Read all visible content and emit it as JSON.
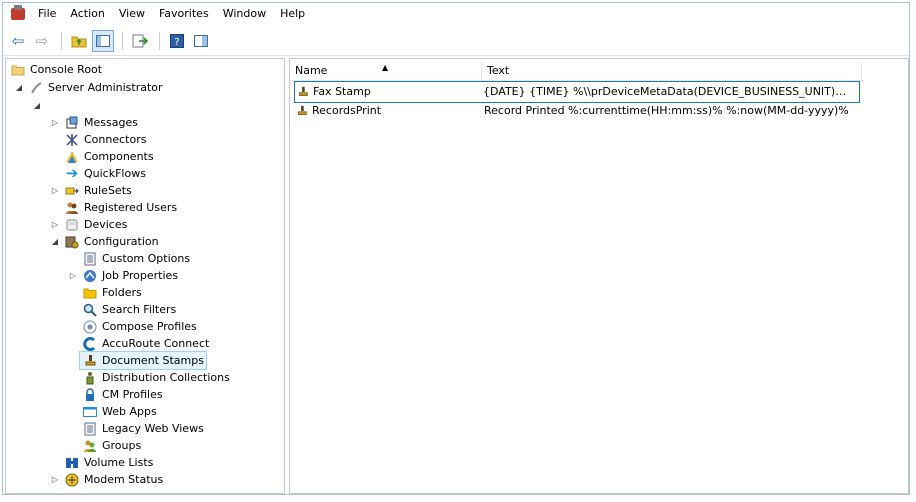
{
  "menu": [
    "File",
    "Action",
    "View",
    "Favorites",
    "Window",
    "Help"
  ],
  "toolbar": {
    "icons": [
      "back-arrow-icon",
      "forward-arrow-icon",
      "folder-up-icon",
      "show-hide-tree-icon",
      "export-list-icon",
      "help-icon",
      "properties-pane-icon"
    ]
  },
  "tree": {
    "root": "Console Root",
    "server": "Server Administrator",
    "messages": "Messages",
    "connectors": "Connectors",
    "components": "Components",
    "quickflows": "QuickFlows",
    "rulesets": "RuleSets",
    "registered_users": "Registered Users",
    "devices": "Devices",
    "configuration": "Configuration",
    "custom_options": "Custom Options",
    "job_properties": "Job Properties",
    "folders": "Folders",
    "search_filters": "Search Filters",
    "compose_profiles": "Compose Profiles",
    "accuroute_connect": "AccuRoute Connect",
    "document_stamps": "Document Stamps",
    "distribution_collections": "Distribution Collections",
    "cm_profiles": "CM Profiles",
    "web_apps": "Web Apps",
    "legacy_web_views": "Legacy Web Views",
    "groups": "Groups",
    "volume_lists": "Volume Lists",
    "modem_status": "Modem Status"
  },
  "list": {
    "columns": [
      "Name",
      "Text"
    ],
    "rows": [
      {
        "name": "Fax Stamp",
        "text": "{DATE} {TIME}  %\\\\prDeviceMetaData(DEVICE_BUSINESS_UNIT)%  %\\\\pr..."
      },
      {
        "name": "RecordsPrint",
        "text": "Record Printed %:currenttime(HH:mm:ss)% %:now(MM-dd-yyyy)%"
      }
    ]
  }
}
